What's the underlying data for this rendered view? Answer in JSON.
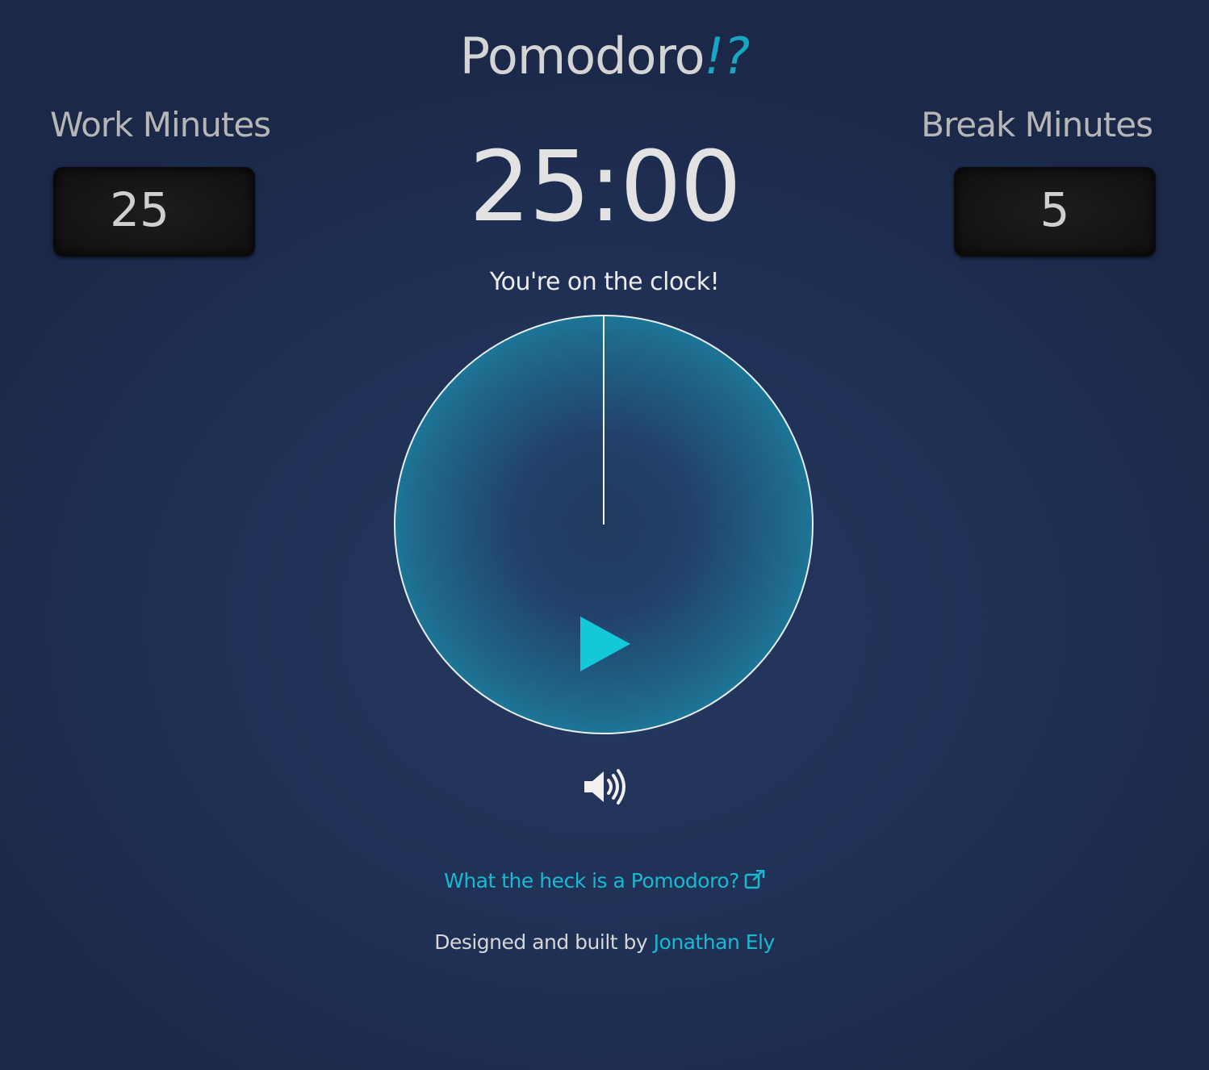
{
  "header": {
    "title_main": "Pomodoro",
    "title_accent": "!?"
  },
  "work": {
    "label": "Work Minutes",
    "value": "25"
  },
  "break": {
    "label": "Break Minutes",
    "value": "5"
  },
  "timer": {
    "display": "25:00",
    "status": "You're on the clock!"
  },
  "controls": {
    "play_icon": "play-icon",
    "sound_icon": "volume-up-icon"
  },
  "footer": {
    "info_link": "What the heck is a Pomodoro?",
    "info_icon": "external-link-icon",
    "credit_prefix": "Designed and built by",
    "credit_name": "Jonathan Ely"
  },
  "colors": {
    "accent": "#17a7c4",
    "play": "#13c8d8",
    "link": "#1ab9d2"
  }
}
